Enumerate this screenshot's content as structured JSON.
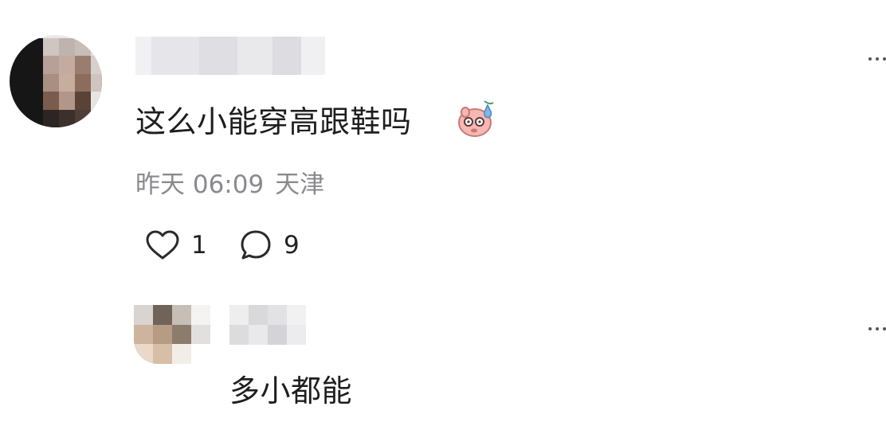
{
  "comment": {
    "text": "这么小能穿高跟鞋吗",
    "emoji": "sweat-smile-pig-emoji",
    "time": "昨天 06:09",
    "location": "天津",
    "likes": "1",
    "replies": "9"
  },
  "reply": {
    "text": "多小都能"
  },
  "colors": {
    "meta_text": "#8a8a8e",
    "body_text": "#1e1e1e",
    "background": "#ffffff",
    "emoji_pink": "#f7b7b2",
    "emoji_blue": "#7fb7e6"
  }
}
